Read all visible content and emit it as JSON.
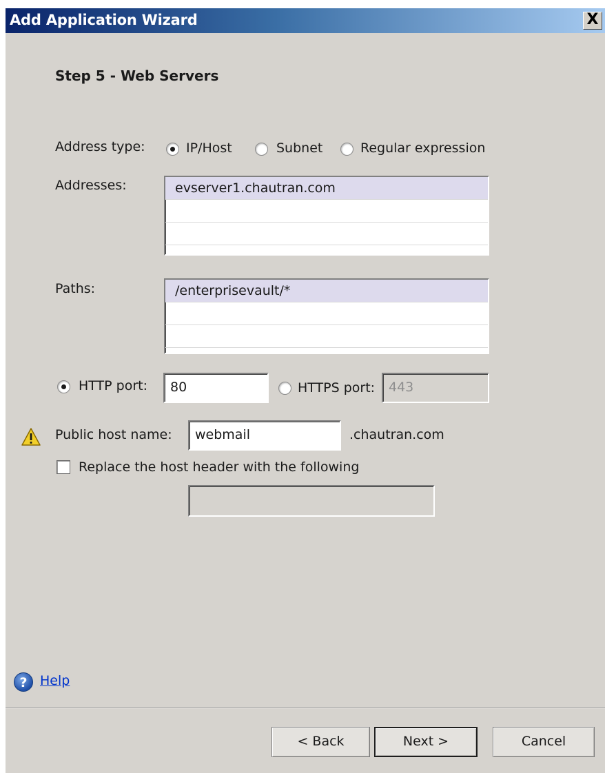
{
  "window": {
    "title": "Add Application Wizard",
    "close_label": "X"
  },
  "step_title": "Step 5 - Web Servers",
  "address_type": {
    "label": "Address type:",
    "options": [
      "IP/Host",
      "Subnet",
      "Regular expression"
    ],
    "selected": "IP/Host"
  },
  "addresses": {
    "label": "Addresses:",
    "items": [
      "evserver1.chautran.com"
    ]
  },
  "paths": {
    "label": "Paths:",
    "items": [
      "/enterprisevault/*"
    ]
  },
  "ports": {
    "http_label": "HTTP port:",
    "http_value": "80",
    "https_label": "HTTPS port:",
    "https_value": "443",
    "selected": "HTTP"
  },
  "public_host": {
    "label": "Public host name:",
    "value": "webmail",
    "suffix": ".chautran.com"
  },
  "replace_header": {
    "label": "Replace the host header with the following",
    "checked": false,
    "value": ""
  },
  "help": {
    "label": "Help"
  },
  "buttons": {
    "back": "< Back",
    "next": "Next >",
    "cancel": "Cancel"
  },
  "icons": {
    "warning": "warning-icon",
    "help": "help-icon",
    "close": "close-icon"
  }
}
